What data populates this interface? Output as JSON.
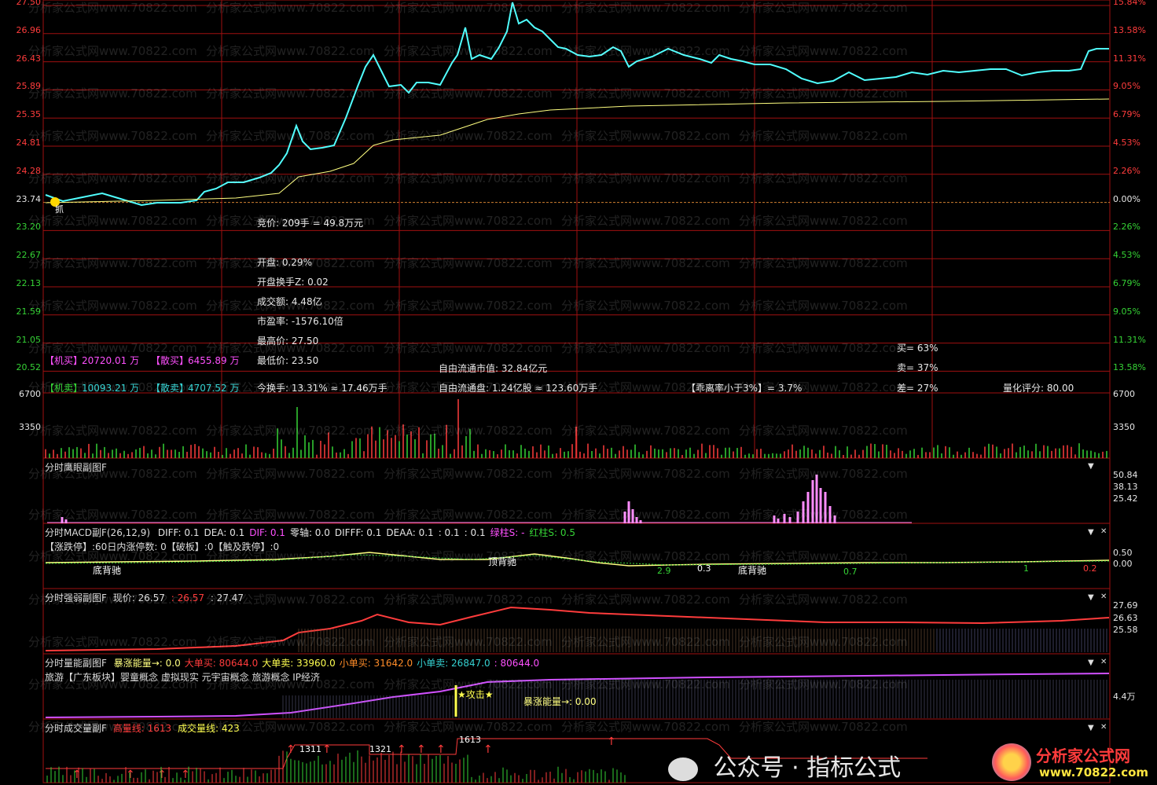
{
  "main_chart": {
    "price_labels": [
      "27.50",
      "26.96",
      "26.43",
      "25.89",
      "25.35",
      "24.81",
      "24.28",
      "23.74",
      "23.20",
      "22.67",
      "22.13",
      "21.59",
      "21.05",
      "20.52"
    ],
    "pct_labels": [
      "15.84%",
      "13.58%",
      "11.31%",
      "9.05%",
      "6.79%",
      "4.53%",
      "2.26%",
      "0.00%",
      "2.26%",
      "4.53%",
      "6.79%",
      "9.05%",
      "11.31%",
      "13.58%"
    ],
    "marker_text": "抓",
    "bid_text": "竞价: 209手 = 49.8万元",
    "info_lines": [
      {
        "label": "开盘:",
        "value": "0.29%"
      },
      {
        "label": "开盘换手Z:",
        "value": "0.02"
      },
      {
        "label": "成交额:",
        "value": "4.48亿"
      },
      {
        "label": "市盈率:",
        "value": "-1576.10倍"
      },
      {
        "label": "最高价:",
        "value": "27.50"
      },
      {
        "label": "最低价:",
        "value": "23.50"
      }
    ],
    "inst_buy": {
      "tag": "【机买】",
      "value": "20720.01 万"
    },
    "retail_buy": {
      "tag": "【散买】",
      "value": "6455.89 万"
    },
    "inst_sell": {
      "tag": "【机卖】",
      "value": "10093.21 万"
    },
    "retail_sell": {
      "tag": "【散卖】",
      "value": "4707.52 万"
    },
    "turnover": "今换手: 13.31% ≈ 17.46万手",
    "float_mcap": "自由流通市值: 32.84亿元",
    "float_shares": "自由流通盘: 1.24亿股 ≈ 123.60万手",
    "deviation": "【乖离率小于3%】= 3.7%",
    "buy_ratio": "买= 63%",
    "sell_ratio": "卖= 37%",
    "diff_ratio": "差= 27%",
    "quant_score": "量化评分: 80.00"
  },
  "volume_panel": {
    "labels": [
      "6700",
      "3350"
    ]
  },
  "eagle_panel": {
    "title": "分时鹰眼副图F",
    "labels": [
      "50.84",
      "38.13",
      "25.42"
    ]
  },
  "macd_panel": {
    "title": "分时MACD副F(26,12,9)",
    "stats": [
      {
        "text": "DIFF: 0.1",
        "color": "#e6e6e6"
      },
      {
        "text": "DEA: 0.1",
        "color": "#e6e6e6"
      },
      {
        "text": "DIF: 0.1",
        "color": "#ff50ff"
      },
      {
        "text": "零轴: 0.0",
        "color": "#e6e6e6"
      },
      {
        "text": "DIFFF: 0.1",
        "color": "#e6e6e6"
      },
      {
        "text": "DEAA: 0.1",
        "color": "#e6e6e6"
      },
      {
        "text": ": 0.1",
        "color": "#e6e6e6"
      },
      {
        "text": ": 0.1",
        "color": "#e6e6e6"
      },
      {
        "text": "绿柱S: -",
        "color": "#ff50ff"
      },
      {
        "text": "红柱S: 0.5",
        "color": "#35d235"
      }
    ],
    "line2": "【涨跌停】:60日内涨停数: 0【破板】:0【触及跌停】:0",
    "labels": [
      "0.50",
      "0.00"
    ],
    "annot": [
      "底背驰",
      "顶背驰",
      "2.9",
      "0.3",
      "底背驰",
      "0.7",
      "1",
      "0.2"
    ]
  },
  "strength_panel": {
    "title": "分时强弱副图F",
    "price_label": "现价: 26.57",
    "v2": ": 26.57",
    "v3": ": 27.47",
    "labels": [
      "27.69",
      "26.63",
      "25.58"
    ]
  },
  "energy_panel": {
    "title": "分时量能副图F",
    "stats": [
      {
        "text": "暴涨能量→: 0.0",
        "color": "#ffff80"
      },
      {
        "text": "大单买: 80644.0",
        "color": "#ff3c3c"
      },
      {
        "text": "大单卖: 33960.0",
        "color": "#ffff50"
      },
      {
        "text": "小单买: 31642.0",
        "color": "#ff8c28"
      },
      {
        "text": "小单卖: 26847.0",
        "color": "#35d2d2"
      },
      {
        "text": ": 80644.0",
        "color": "#ff50ff"
      }
    ],
    "concepts": "旅游【广东板块】婴童概念 虚拟现实 元宇宙概念 旅游概念 IP经济",
    "attack": "★攻击★",
    "surge": "暴涨能量→: 0.00",
    "label": "4.4万"
  },
  "turnover_panel": {
    "title": "分时成交量副F",
    "high_line": "高量线: 1613",
    "vol_line": "成交量线: 423",
    "markers": [
      "1311",
      "1321",
      "1613"
    ]
  },
  "watermark": "分析家公式网www.70822.com",
  "footer": {
    "wechat": "公众号 · 指标公式",
    "brand": "分析家公式网",
    "url": "www.70822.com"
  },
  "colors": {
    "price": "#50ffff",
    "avg": "#ffff80",
    "grid": "#a01010",
    "up": "#ff3c3c",
    "down": "#35d235"
  }
}
